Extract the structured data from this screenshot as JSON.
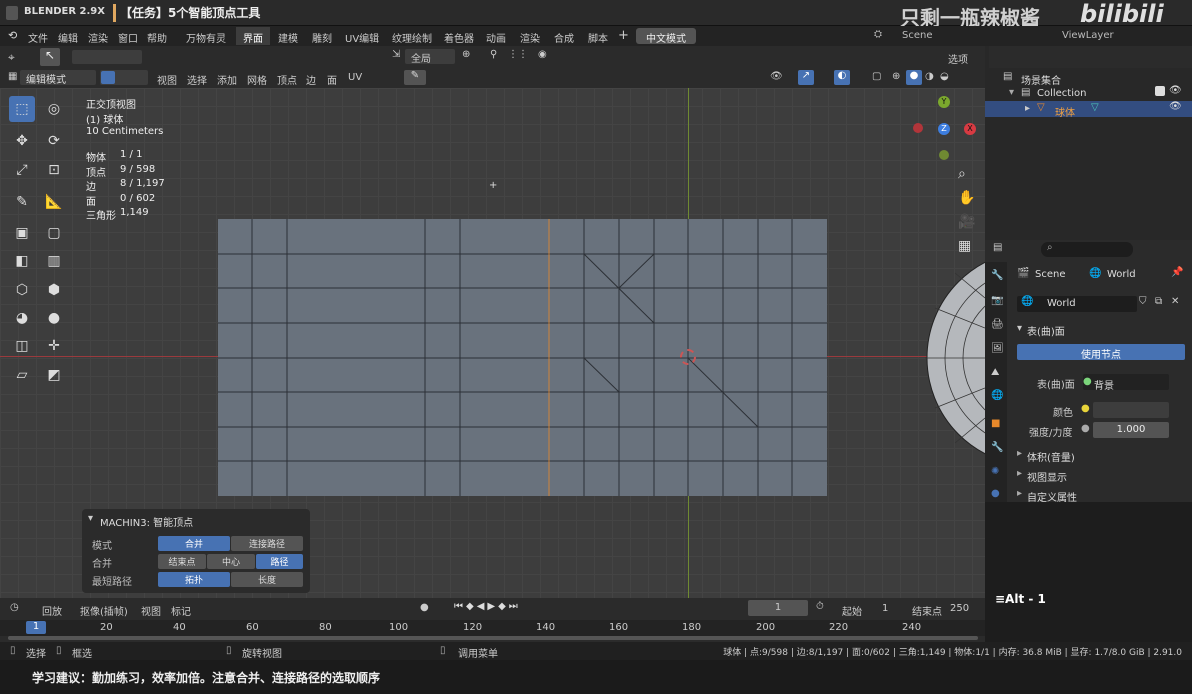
{
  "app": {
    "name": "BLENDER 2.9X",
    "title": "【任务】5个智能顶点工具",
    "workspace_btn": "中文模式",
    "scene": "Scene",
    "view_layer": "ViewLayer",
    "watermark": "只剩一瓶辣椒酱",
    "watermark_logo": "bilibili"
  },
  "menu": [
    "文件",
    "编辑",
    "渲染",
    "窗口",
    "帮助"
  ],
  "tabs": [
    "万物有灵",
    "界面",
    "建模",
    "雕刻",
    "UV编辑",
    "纹理绘制",
    "着色器",
    "动画",
    "渲染",
    "合成",
    "脚本"
  ],
  "active_tab": "界面",
  "viewport_header": {
    "transform_orientation": "全局",
    "options_label": "选项",
    "mode": "编辑模式",
    "menus": [
      "视图",
      "选择",
      "添加",
      "网格",
      "顶点",
      "边",
      "面",
      "UV"
    ]
  },
  "overlay_info": {
    "view": "正交顶视图",
    "object": "(1) 球体",
    "scale": "10 Centimeters",
    "stats": [
      {
        "label": "物体",
        "value": "1 / 1"
      },
      {
        "label": "顶点",
        "value": "9 / 598"
      },
      {
        "label": "边",
        "value": "8 / 1,197"
      },
      {
        "label": "面",
        "value": "0 / 602"
      },
      {
        "label": "三角形",
        "value": "1,149"
      }
    ]
  },
  "operator_panel": {
    "title": "MACHIN3: 智能顶点",
    "rows": [
      {
        "label": "模式",
        "options": [
          "合并",
          "连接路径"
        ],
        "selected": 0
      },
      {
        "label": "合并",
        "options": [
          "结束点",
          "中心",
          "路径"
        ],
        "selected": 2
      },
      {
        "label": "最短路径",
        "options": [
          "拓扑",
          "长度"
        ],
        "selected": 0
      }
    ]
  },
  "outliner": {
    "items": [
      {
        "label": "场景集合"
      },
      {
        "label": "Collection"
      },
      {
        "label": "球体"
      }
    ]
  },
  "properties": {
    "breadcrumb": [
      "Scene",
      "World"
    ],
    "world_name": "World",
    "section": "表(曲)面",
    "use_nodes": "使用节点",
    "surface_label": "表(曲)面",
    "surface_value": "背景",
    "color_label": "颜色",
    "strength_label": "强度/力度",
    "strength_value": "1.000",
    "collapsed": [
      "体积(音量)",
      "视图显示",
      "自定义属性"
    ],
    "keystroke": "≡Alt - 1"
  },
  "timeline": {
    "menus": [
      "回放",
      "抠像(插帧)",
      "视图",
      "标记"
    ],
    "current_frame": "1",
    "start_label": "起始",
    "start_value": "1",
    "end_label": "结束点",
    "end_value": "250",
    "ticks": [
      "1",
      "20",
      "40",
      "60",
      "80",
      "100",
      "120",
      "140",
      "160",
      "180",
      "200",
      "220",
      "240"
    ]
  },
  "status": {
    "left": [
      "选择",
      "框选",
      "旋转视图",
      "调用菜单"
    ],
    "right": "球体 | 点:9/598 | 边:8/1,197 | 面:0/602 | 三角:1,149 | 物体:1/1 | 内存: 36.8 MiB | 显存: 1.7/8.0 GiB | 2.91.0"
  },
  "subtitle": "学习建议：勤加练习，效率加倍。注意合并、连接路径的选取顺序",
  "colors": {
    "accent": "#4772b3",
    "selected_edge": "#e8892b",
    "mesh_face": "#69727d",
    "x_axis": "#b2353a",
    "y_axis": "#7ba82d"
  }
}
